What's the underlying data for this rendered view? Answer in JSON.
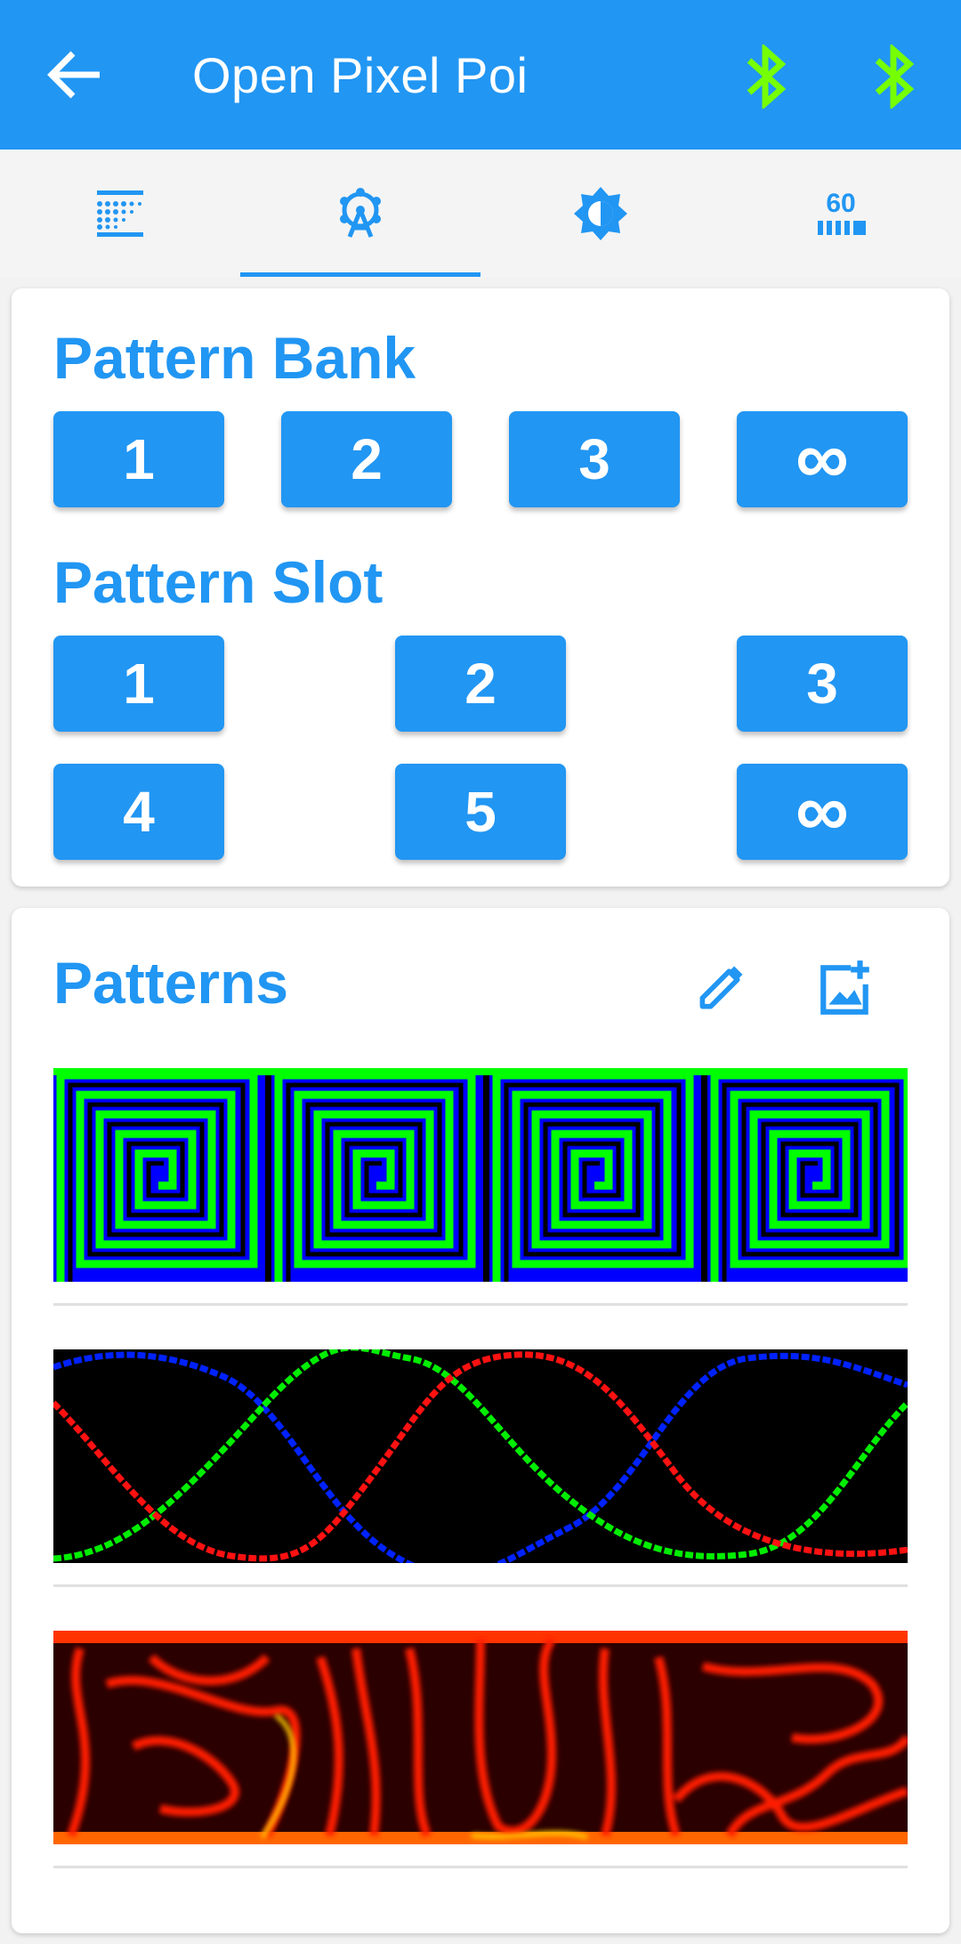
{
  "app": {
    "title": "Open Pixel Poi",
    "accent": "#2196f3",
    "bluetooth_color": "#76ff03"
  },
  "tabs": [
    {
      "icon": "led-grid-icon",
      "selected": false
    },
    {
      "icon": "ferris-wheel-icon",
      "selected": true
    },
    {
      "icon": "brightness-icon",
      "selected": false
    },
    {
      "icon": "fps-60-icon",
      "selected": false
    }
  ],
  "bank": {
    "title": "Pattern Bank",
    "buttons": [
      "1",
      "2",
      "3",
      "∞"
    ]
  },
  "slot": {
    "title": "Pattern Slot",
    "buttons": [
      "1",
      "2",
      "3",
      "4",
      "5",
      "∞"
    ]
  },
  "patterns": {
    "title": "Patterns",
    "edit_icon": "pencil-icon",
    "add_icon": "add-image-icon",
    "items": [
      {
        "name": "greek-key-spiral",
        "colors": [
          "#00ff00",
          "#0000ff",
          "#000000"
        ]
      },
      {
        "name": "rgb-sine-waves",
        "colors": [
          "#ff0000",
          "#00ff00",
          "#0000ff",
          "#000000"
        ]
      },
      {
        "name": "fire-swirls",
        "colors": [
          "#ff2200",
          "#ffcc00",
          "#550000"
        ]
      }
    ]
  }
}
